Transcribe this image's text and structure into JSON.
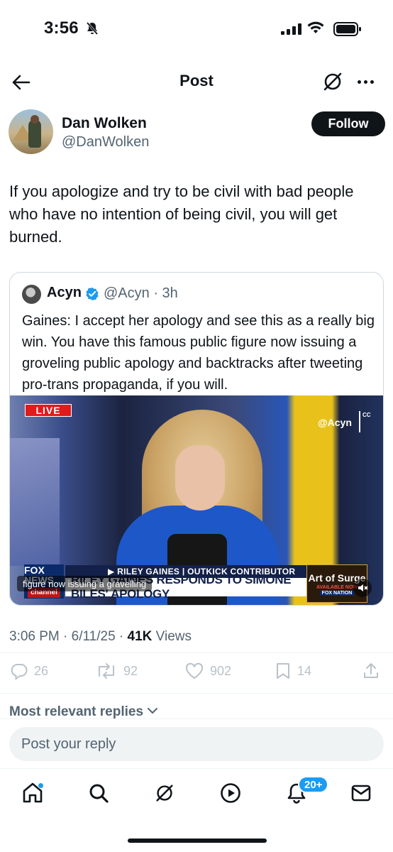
{
  "status_bar": {
    "time": "3:56",
    "icons": [
      "bell-slash-icon",
      "signal-icon",
      "wifi-icon",
      "battery-icon"
    ]
  },
  "header": {
    "title": "Post",
    "back_icon": "arrow-left-icon",
    "grok_icon": "grok-icon",
    "more_icon": "more-icon"
  },
  "author": {
    "name": "Dan Wolken",
    "handle": "@DanWolken",
    "follow_label": "Follow"
  },
  "tweet": {
    "text": "If you apologize and try to be civil with bad people who have no intention of being civil, you will get burned."
  },
  "quote": {
    "name": "Acyn",
    "verified": true,
    "handle_time": "@Acyn · 3h",
    "text": "Gaines: I accept her apology and see this as a really big win. You have this famous public figure now issuing a groveling public apology and backtracks after tweeting pro-trans propaganda, if you will.",
    "video": {
      "live_label": "LIVE",
      "watermark": "@Acyn",
      "cc_label": "CC",
      "network_logo": "FOX NEWS",
      "network_channel": "channel",
      "lower_third_top": "▶ RILEY GAINES | OUTKICK CONTRIBUTOR",
      "lower_third_main": "RILEY GAINES RESPONDS TO SIMONE BILES' APOLOGY",
      "caption": "figure now issuing a gravelling",
      "promo_title": "Art of Surge",
      "promo_avail": "AVAILABLE NOW",
      "promo_network": "FOX NATION"
    }
  },
  "meta": {
    "time": "3:06 PM",
    "date": "6/11/25",
    "views_count": "41K",
    "views_label": "Views"
  },
  "actions": {
    "replies": "26",
    "reposts": "92",
    "likes": "902",
    "bookmarks": "14"
  },
  "replies_sort": {
    "label": "Most relevant replies"
  },
  "reply_box": {
    "placeholder": "Post your reply"
  },
  "bottom_nav": {
    "items": [
      "home-icon",
      "search-icon",
      "grok-icon",
      "video-icon",
      "notifications-icon",
      "messages-icon"
    ],
    "notifications_badge": "20+"
  },
  "colors": {
    "text": "#0f1419",
    "secondary": "#536471",
    "accent": "#1d9bf0",
    "border": "#cfd9de"
  }
}
